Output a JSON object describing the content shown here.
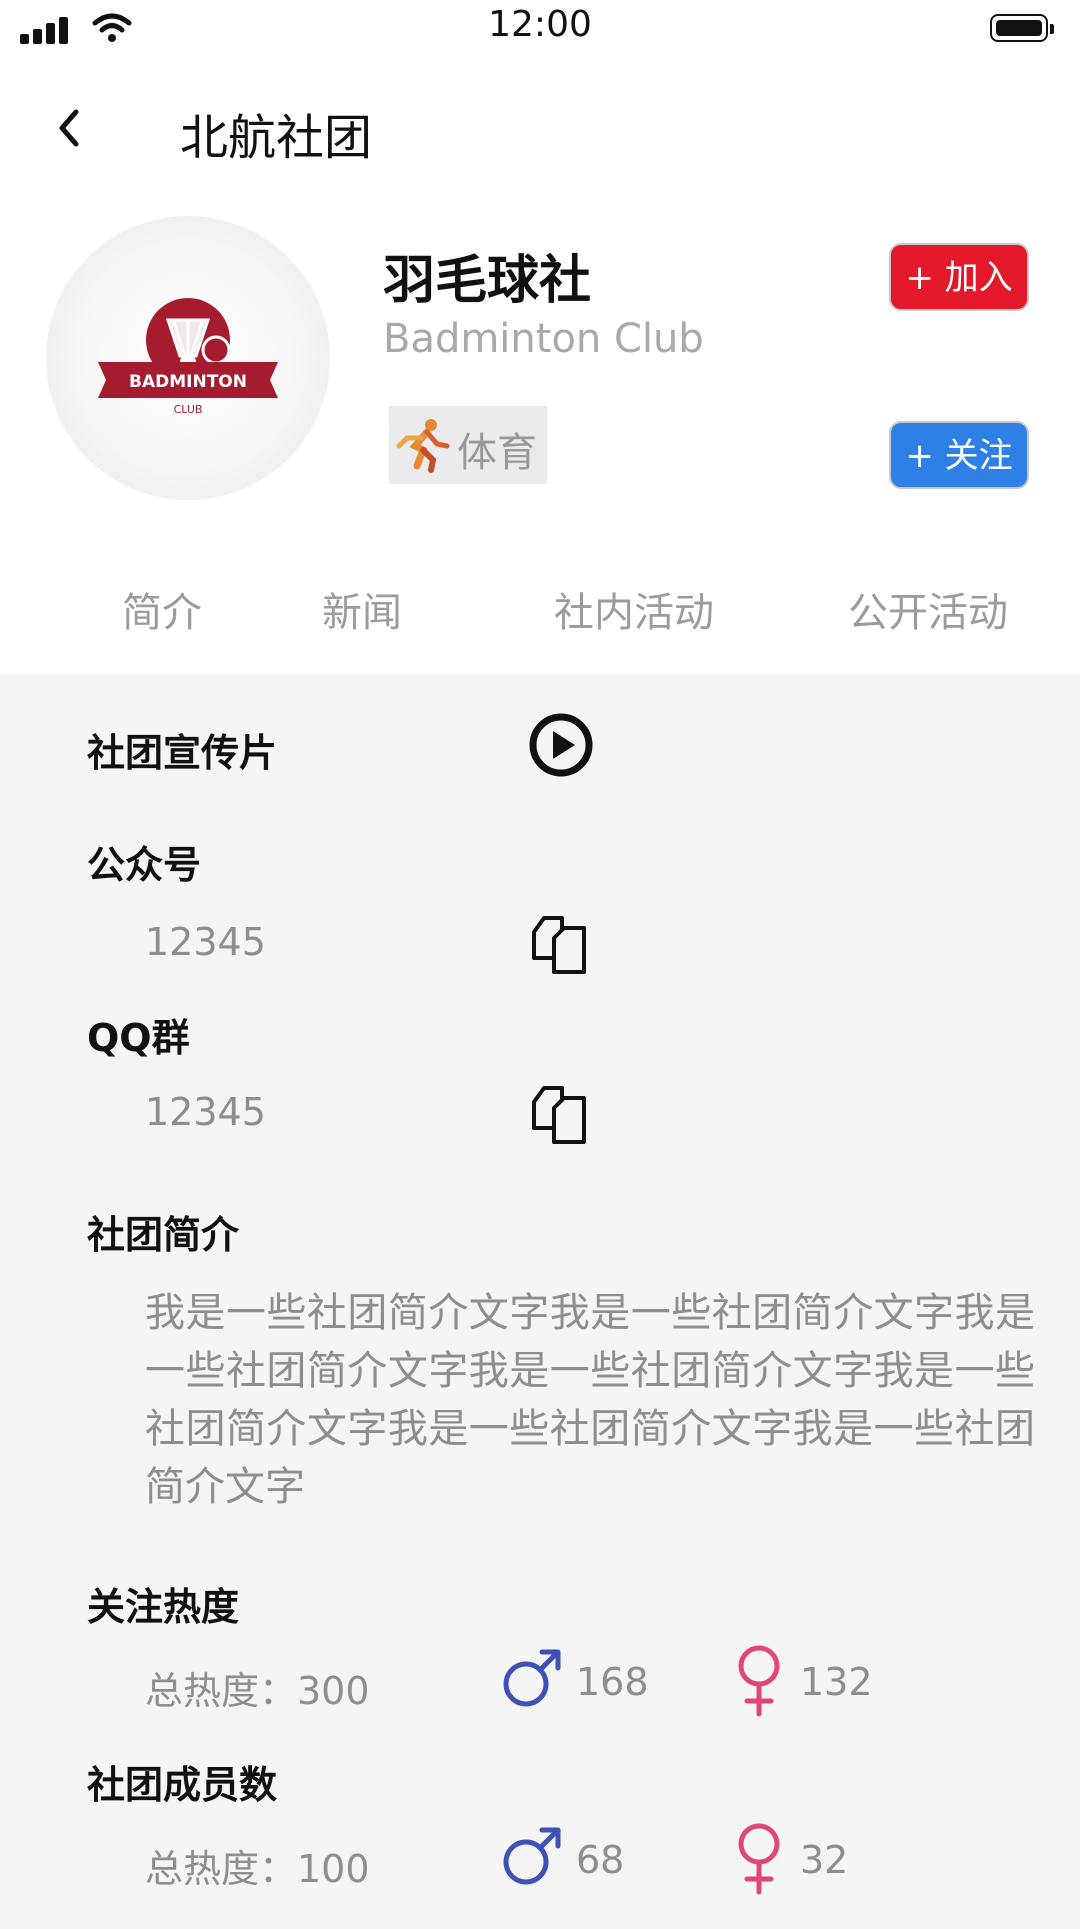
{
  "status_bar": {
    "time": "12:00"
  },
  "header": {
    "title": "北航社团"
  },
  "club": {
    "name": "羽毛球社",
    "name_en": "Badminton Club",
    "logo_text": "BADMINTON",
    "logo_subtext": "CLUB",
    "category": "体育"
  },
  "actions": {
    "join_label": "+ 加入",
    "follow_label": "+ 关注"
  },
  "tabs": [
    {
      "label": "简介"
    },
    {
      "label": "新闻"
    },
    {
      "label": "社内活动"
    },
    {
      "label": "公开活动"
    }
  ],
  "sections": {
    "video": {
      "title": "社团宣传片"
    },
    "wechat": {
      "title": "公众号",
      "value": "12345"
    },
    "qq": {
      "title": "QQ群",
      "value": "12345"
    },
    "intro": {
      "title": "社团简介",
      "text": "我是一些社团简介文字我是一些社团简介文字我是一些社团简介文字我是一些社团简介文字我是一些社团简介文字我是一些社团简介文字我是一些社团简介文字"
    },
    "popularity": {
      "title": "关注热度",
      "total_label": "总热度：300",
      "male": "168",
      "female": "132"
    },
    "members": {
      "title": "社团成员数",
      "total_label": "总热度：100",
      "male": "68",
      "female": "32"
    }
  },
  "colors": {
    "join": "#e3192b",
    "follow": "#2f80e6",
    "male": "#3f51b5",
    "female": "#e0457b",
    "logo": "#a51c2f"
  },
  "icons": [
    "chevron-left-icon",
    "play-icon",
    "copy-icon",
    "male-icon",
    "female-icon",
    "runner-icon"
  ]
}
